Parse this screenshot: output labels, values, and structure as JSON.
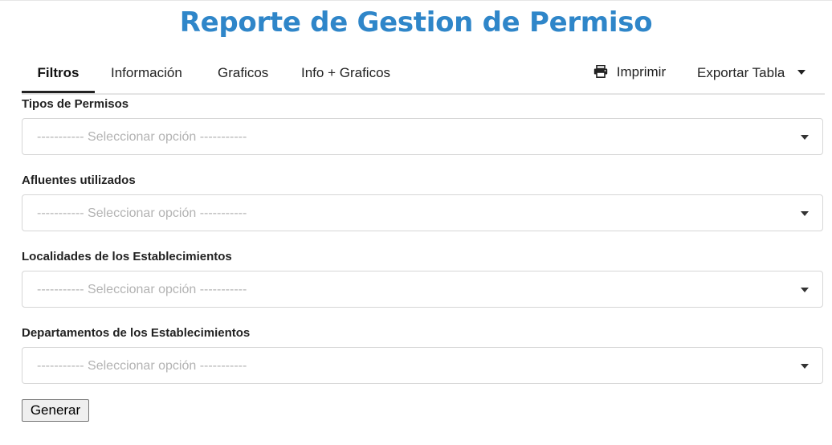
{
  "page": {
    "title": "Reporte de Gestion de Permiso"
  },
  "tabs": [
    {
      "label": "Filtros",
      "active": true
    },
    {
      "label": "Información",
      "active": false
    },
    {
      "label": "Graficos",
      "active": false
    },
    {
      "label": "Info + Graficos",
      "active": false
    }
  ],
  "actions": {
    "print_label": "Imprimir",
    "print_icon": "printer-icon",
    "export_label": "Exportar Tabla",
    "export_icon": "caret-down-icon"
  },
  "filters": [
    {
      "label": "Tipos de Permisos",
      "placeholder": "----------- Seleccionar opción -----------"
    },
    {
      "label": "Afluentes utilizados",
      "placeholder": "----------- Seleccionar opción -----------"
    },
    {
      "label": "Localidades de los Establecimientos",
      "placeholder": "----------- Seleccionar opción -----------"
    },
    {
      "label": "Departamentos de los Establecimientos",
      "placeholder": "----------- Seleccionar opción -----------"
    }
  ],
  "submit": {
    "label": "Generar"
  },
  "colors": {
    "title": "#2f86c9",
    "text": "#222222",
    "placeholder": "#b3b3b3",
    "border": "#d6d6d6"
  }
}
